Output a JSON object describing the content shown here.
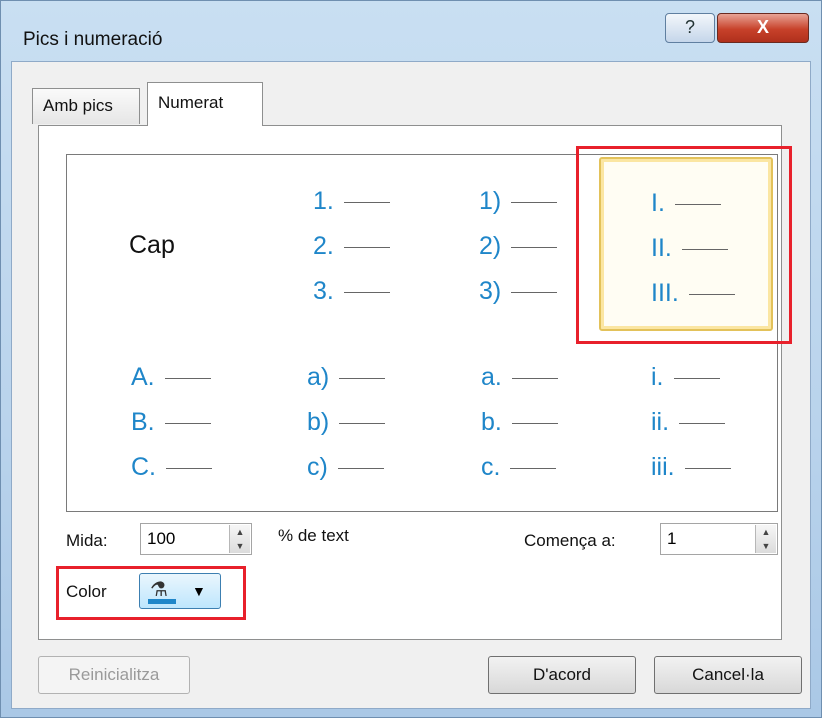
{
  "window": {
    "title": "Pics i numeració",
    "help_label": "?",
    "close_label": "X"
  },
  "tabs": [
    {
      "label": "Amb pics",
      "active": false
    },
    {
      "label": "Numerat",
      "active": true
    }
  ],
  "gallery": {
    "none_label": "Cap",
    "styles": [
      {
        "items": [
          "1.",
          "2.",
          "3."
        ]
      },
      {
        "items": [
          "1)",
          "2)",
          "3)"
        ]
      },
      {
        "items": [
          "I.",
          "II.",
          "III."
        ],
        "selected": true
      },
      {
        "items": [
          "A.",
          "B.",
          "C."
        ]
      },
      {
        "items": [
          "a)",
          "b)",
          "c)"
        ]
      },
      {
        "items": [
          "a.",
          "b.",
          "c."
        ]
      },
      {
        "items": [
          "i.",
          "ii.",
          "iii."
        ]
      }
    ],
    "accent_color": "#1f86c9",
    "highlight_color": "#e8202b"
  },
  "size": {
    "label": "Mida:",
    "value": "100",
    "suffix": "% de text"
  },
  "start_at": {
    "label": "Comença a:",
    "value": "1"
  },
  "color": {
    "label": "Color",
    "swatch": "#1f86c9",
    "icon": "paint-bucket-icon"
  },
  "buttons": {
    "reset": "Reinicialitza",
    "ok": "D'acord",
    "cancel": "Cancel·la"
  }
}
